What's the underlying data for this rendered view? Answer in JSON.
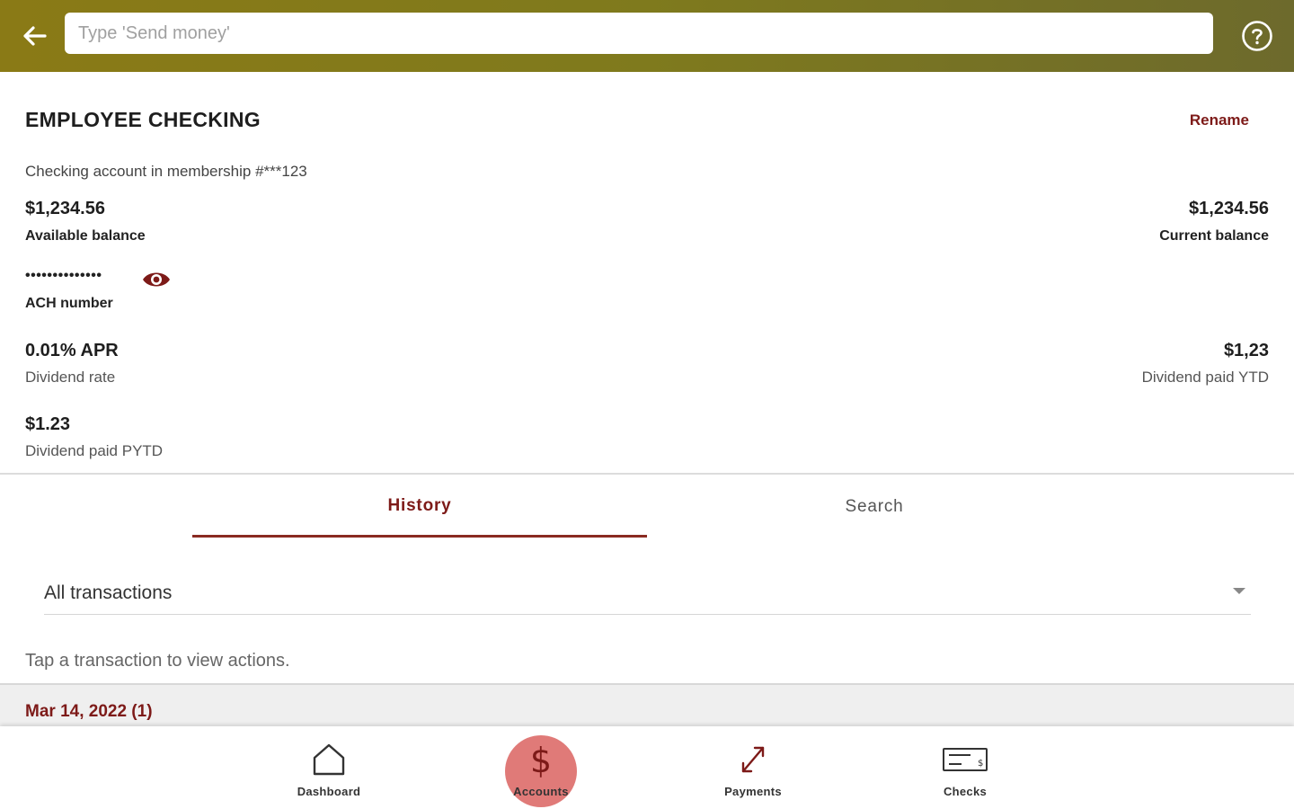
{
  "colors": {
    "accent": "#7d1a18",
    "header_start": "#8a7a16",
    "header_end": "#6d6a2c",
    "active_nav_bg": "#e07a78"
  },
  "header": {
    "back_icon": "arrow-left-icon",
    "search_placeholder": "Type 'Send money'",
    "help_icon": "help-circle-icon"
  },
  "account": {
    "title": "EMPLOYEE CHECKING",
    "rename_label": "Rename",
    "membership": "Checking account in membership #***123",
    "available_balance": "$1,234.56",
    "available_balance_label": "Available balance",
    "current_balance": "$1,234.56",
    "current_balance_label": "Current balance",
    "ach_masked": "••••••••••••••",
    "ach_label": "ACH number",
    "reveal_icon": "eye-icon",
    "apr": "0.01% APR",
    "apr_label": "Dividend rate",
    "dividend_ytd": "$1,23",
    "dividend_ytd_label": "Dividend paid YTD",
    "dividend_pytd": "$1.23",
    "dividend_pytd_label": "Dividend paid PYTD"
  },
  "tabs": [
    {
      "label": "History",
      "active": true
    },
    {
      "label": "Search",
      "active": false
    }
  ],
  "filter": {
    "selected": "All transactions"
  },
  "hint": "Tap a transaction to view actions.",
  "date_group": "Mar 14, 2022 (1)",
  "bottom_nav": [
    {
      "label": "Dashboard",
      "icon": "home-icon",
      "active": false
    },
    {
      "label": "Accounts",
      "icon": "dollar-icon",
      "active": true
    },
    {
      "label": "Payments",
      "icon": "transfer-arrows-icon",
      "active": false
    },
    {
      "label": "Checks",
      "icon": "check-icon",
      "active": false
    }
  ]
}
